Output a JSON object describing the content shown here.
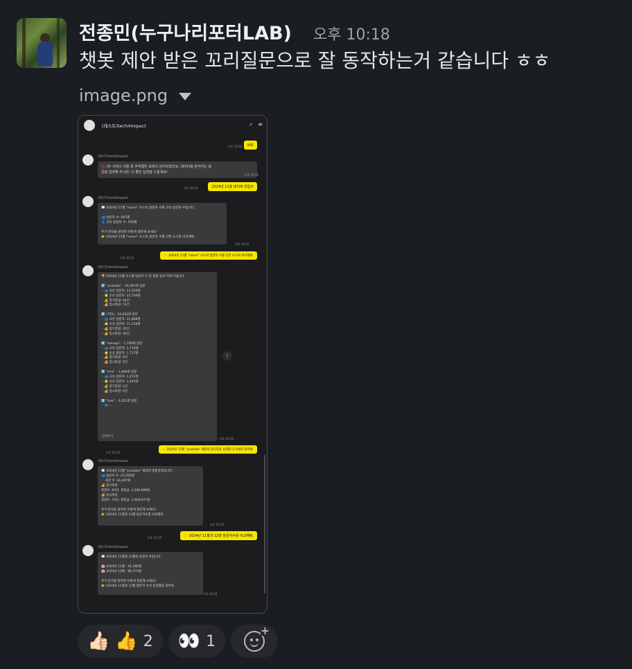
{
  "message": {
    "author": "전종민(누구나리포터LAB)",
    "time": "오후 10:18",
    "text": "챗봇 제안 받은 꼬리질문으로 잘 동작하는거 같습니다 ㅎㅎ"
  },
  "attachment": {
    "filename": "image.png",
    "toggle_icon": "caret-down-icon"
  },
  "screenshot": {
    "title": "(테스트)tech4impact",
    "bot_name": "(테스트)tech4impact",
    "y1": "바보",
    "t1": "오후 10:04",
    "warn": "🚫 앗! 서비스 이용 중 부적절한 표현이 감지되었어요. 데이터를 분석하는 질\n문을 입력해 주시면, 더 좋은 답변을 드릴게요!",
    "t2": "오후 10:04",
    "y2": "2024년 11월 네이버 유입수",
    "t3": "오후 10:14",
    "r1": "💬 2024년 11월 \"naver\" 소스의 방문자 수와 고유 방문자 수입니다.\n\n👥 방문자 수: 663회\n👤 고유 방문자 수: 555명\n\n추가 분석을 원하면 이렇게 질문해 보세요!\n👉 2024년 11월 \"naver\" 소스의 방문자 수를 다른 소스와 비교해줘.",
    "t4": "오후 10:15",
    "y3": "👉 2024년 11월 \"naver\" 소스의 방문자 수를 다른 소스와 비교해줘.",
    "t5": "오후 10:15",
    "r2": "🏆 2024년 11월 소스별 방문자 수 및 후원 성과 TOP-5입니다.\n\n1️⃣ \"youtube\" - 26,497회 방문\n - 👥 고유 방문자: 23,556명\n - 🌟 신규 방문자: 22,704명\n - 💰 정기후원: 64건\n - 💰 일시후원: 74건\n\n2️⃣ (기타) - 16,042회 방문\n - 👥 고유 방문자: 11,888명\n - 🌟 신규 방문자: 11,116명\n - 💰 정기후원: 25건\n - 💰 일시후원: 38건\n\n3️⃣ \"danngn\" - 1,748회 방문\n - 👥 고유 방문자: 1,719명\n - 🌟 신규 방문자: 1,717명\n - 💰 정기후원: 0건\n - 💰 일시후원: 0건\n\n4️⃣ \"sms\" - 1,486회 방문\n - 👥 고유 방문자: 1,272명\n - 🌟 신규 방문자: 1,023명\n - 💰 정기후원: 1건\n - 💰 일시후원: 0건\n\n5️⃣ \"toss\" - 1,015회 방문\n - 👥 ...",
    "more": "전체보기",
    "t6": "오후 10:15",
    "y4": "👉 2024년 11월 \"youtube\" 채널의 정기후원 성과를 더 자세히 알려줘.",
    "t7": "오후 10:15",
    "r3": "💬 2024년 11월 \"youtube\" 채널의 후원성과입니다.\n👥 방문자 수: 23,556명\n    세션 수: 26,497회\n💰 정기후원\n후원수: 64건, 후원금: 1,040,999원\n💰 일시후원\n후원수: 74건, 후원금: 1,904,977원\n\n추가 분석을 원하면 이렇게 질문해 보세요!\n👉 2024년 11월과 12월 방문자수를 비교해줘.",
    "t8": "오후 10:15",
    "y5": "👉 2024년 11월과 12월 방문자수를 비교해줘.",
    "t9": "오후 10:15",
    "r4": "💬 2024년 11월과 12월의 방문자 수입니다.\n\n📅 2024년 11월 : 41,280명\n📅 2024년 12월 : 86,574명\n\n추가 분석을 원하면 이렇게 질문해 보세요!\n👉 2024년 11월과 12월 방문자 수의 증감률을 알려줘.",
    "t10": "오후 10:16"
  },
  "reactions": [
    {
      "emoji": "👍🏻",
      "emoji2": "👍",
      "count": "2"
    },
    {
      "emoji": "👀",
      "count": "1"
    }
  ]
}
